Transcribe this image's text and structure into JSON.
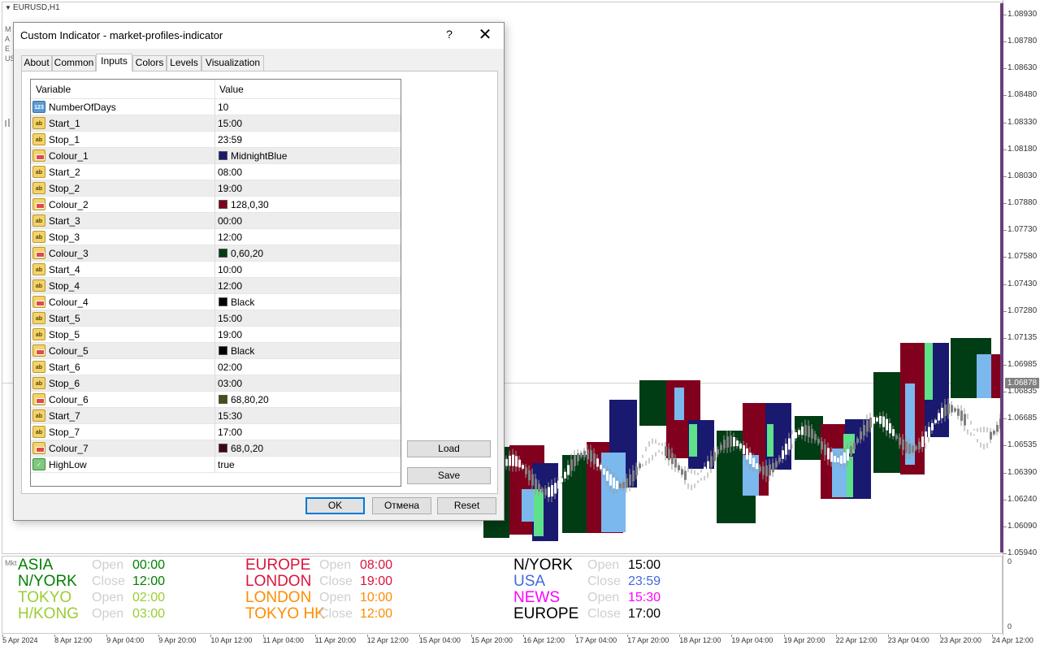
{
  "chart": {
    "symbol": "EURUSD,H1",
    "hidden_info": [
      "M",
      "A",
      "E",
      "US"
    ],
    "price_labels": [
      "1.08930",
      "1.08780",
      "1.08630",
      "1.08480",
      "1.08330",
      "1.08180",
      "1.08030",
      "1.07880",
      "1.07730",
      "1.07580",
      "1.07430",
      "1.07280",
      "1.07135",
      "1.06985",
      "1.06835",
      "1.06685",
      "1.06535",
      "1.06390",
      "1.06240",
      "1.06090",
      "1.05940"
    ],
    "current_price": "1.06878",
    "sub_labels": [
      "0",
      "0"
    ],
    "time_labels": [
      "5 Apr 2024",
      "8 Apr 12:00",
      "9 Apr 04:00",
      "9 Apr 20:00",
      "10 Apr 12:00",
      "11 Apr 04:00",
      "11 Apr 20:00",
      "12 Apr 12:00",
      "15 Apr 04:00",
      "15 Apr 20:00",
      "16 Apr 12:00",
      "17 Apr 04:00",
      "17 Apr 20:00",
      "18 Apr 12:00",
      "19 Apr 04:00",
      "19 Apr 20:00",
      "22 Apr 12:00",
      "23 Apr 04:00",
      "23 Apr 20:00",
      "24 Apr 12:00"
    ],
    "mkt_tag": "Mkt",
    "colors": {
      "midnight_blue": "#191970",
      "maroon": "#80001e",
      "dark_green": "#003c14",
      "light_blue": "#7ab8ee",
      "light_green": "#5fe08a",
      "bronze": "#8a5a2a",
      "purple": "#7a2a7a"
    }
  },
  "legend": [
    {
      "name": "ASIA",
      "state": "Open",
      "time": "00:00",
      "name_color": "#008000",
      "time_color": "#008000"
    },
    {
      "name": "N/YORK",
      "state": "Close",
      "time": "12:00",
      "name_color": "#008000",
      "time_color": "#008000"
    },
    {
      "name": "TOKYO",
      "state": "Open",
      "time": "02:00",
      "name_color": "#9acd32",
      "time_color": "#9acd32"
    },
    {
      "name": "H/KONG",
      "state": "Open",
      "time": "03:00",
      "name_color": "#9acd32",
      "time_color": "#9acd32"
    },
    {
      "name": "EUROPE",
      "state": "Open",
      "time": "08:00",
      "name_color": "#dc143c",
      "time_color": "#dc143c"
    },
    {
      "name": "LONDON",
      "state": "Close",
      "time": "19:00",
      "name_color": "#dc143c",
      "time_color": "#dc143c"
    },
    {
      "name": "LONDON",
      "state": "Open",
      "time": "10:00",
      "name_color": "#ff8c00",
      "time_color": "#ff8c00"
    },
    {
      "name": "TOKYO HK",
      "state": "Close",
      "time": "12:00",
      "name_color": "#ff8c00",
      "time_color": "#ff8c00"
    },
    {
      "name": "N/YORK",
      "state": "Open",
      "time": "15:00",
      "name_color": "#000000",
      "time_color": "#000000"
    },
    {
      "name": "USA",
      "state": "Close",
      "time": "23:59",
      "name_color": "#4169e1",
      "time_color": "#4169e1"
    },
    {
      "name": "NEWS",
      "state": "Open",
      "time": "15:30",
      "name_color": "#ff00ff",
      "time_color": "#ff00ff"
    },
    {
      "name": "EUROPE",
      "state": "Close",
      "time": "17:00",
      "name_color": "#000000",
      "time_color": "#000000"
    }
  ],
  "dialog": {
    "title": "Custom Indicator - market-profiles-indicator",
    "help": "?",
    "close": "✕",
    "tabs": [
      "About",
      "Common",
      "Inputs",
      "Colors",
      "Levels",
      "Visualization"
    ],
    "active_tab": "Inputs",
    "grid": {
      "col_variable": "Variable",
      "col_value": "Value",
      "rows": [
        {
          "name": "NumberOfDays",
          "value": "10",
          "type": "num"
        },
        {
          "name": "Start_1",
          "value": "15:00",
          "type": "str"
        },
        {
          "name": "Stop_1",
          "value": "23:59",
          "type": "str"
        },
        {
          "name": "Colour_1",
          "value": "MidnightBlue",
          "type": "clr",
          "swatch": "#191970"
        },
        {
          "name": "Start_2",
          "value": "08:00",
          "type": "str"
        },
        {
          "name": "Stop_2",
          "value": "19:00",
          "type": "str"
        },
        {
          "name": "Colour_2",
          "value": "128,0,30",
          "type": "clr",
          "swatch": "#80001e"
        },
        {
          "name": "Start_3",
          "value": "00:00",
          "type": "str"
        },
        {
          "name": "Stop_3",
          "value": "12:00",
          "type": "str"
        },
        {
          "name": "Colour_3",
          "value": "0,60,20",
          "type": "clr",
          "swatch": "#003c14"
        },
        {
          "name": "Start_4",
          "value": "10:00",
          "type": "str"
        },
        {
          "name": "Stop_4",
          "value": "12:00",
          "type": "str"
        },
        {
          "name": "Colour_4",
          "value": "Black",
          "type": "clr",
          "swatch": "#000000"
        },
        {
          "name": "Start_5",
          "value": "15:00",
          "type": "str"
        },
        {
          "name": "Stop_5",
          "value": "19:00",
          "type": "str"
        },
        {
          "name": "Colour_5",
          "value": "Black",
          "type": "clr",
          "swatch": "#000000"
        },
        {
          "name": "Start_6",
          "value": "02:00",
          "type": "str"
        },
        {
          "name": "Stop_6",
          "value": "03:00",
          "type": "str"
        },
        {
          "name": "Colour_6",
          "value": "68,80,20",
          "type": "clr",
          "swatch": "#445014"
        },
        {
          "name": "Start_7",
          "value": "15:30",
          "type": "str"
        },
        {
          "name": "Stop_7",
          "value": "17:00",
          "type": "str"
        },
        {
          "name": "Colour_7",
          "value": "68,0,20",
          "type": "clr",
          "swatch": "#440014"
        },
        {
          "name": "HighLow",
          "value": "true",
          "type": "bool"
        }
      ]
    },
    "buttons": {
      "load": "Load",
      "save": "Save",
      "ok": "OK",
      "cancel": "Отмена",
      "reset": "Reset"
    }
  }
}
